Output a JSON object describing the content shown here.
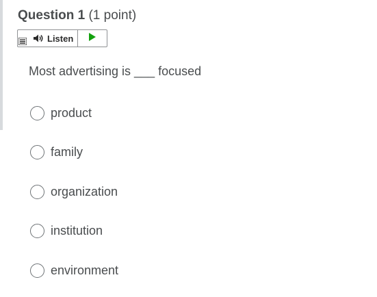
{
  "question": {
    "title": "Question 1",
    "points": "(1 point)"
  },
  "toolbar": {
    "menu_icon": "menu-icon",
    "speaker_icon": "speaker-icon",
    "listen_label": "Listen",
    "play_icon": "play-icon",
    "accent_color": "#13a10e"
  },
  "prompt": "Most advertising is ___ focused",
  "options": [
    {
      "label": "product"
    },
    {
      "label": "family"
    },
    {
      "label": "organization"
    },
    {
      "label": "institution"
    },
    {
      "label": "environment"
    }
  ]
}
